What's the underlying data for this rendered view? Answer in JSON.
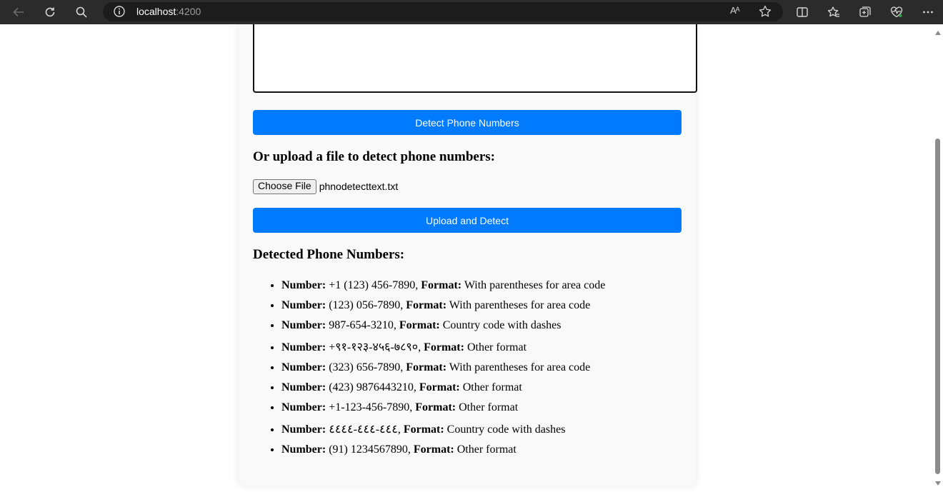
{
  "browser": {
    "url_host": "localhost",
    "url_port": ":4200",
    "read_aloud_glyph": "Aᴬ",
    "icons": [
      "back-icon",
      "refresh-icon",
      "search-icon",
      "site-info-icon",
      "read-aloud-icon",
      "favorite-star-icon",
      "split-screen-icon",
      "favorites-icon",
      "collections-icon",
      "browser-essentials-icon",
      "more-menu-icon"
    ]
  },
  "form": {
    "textarea_value": "",
    "detect_button": "Detect Phone Numbers",
    "upload_heading": "Or upload a file to detect phone numbers:",
    "choose_file_label": "Choose File",
    "file_name": "phnodetecttext.txt",
    "upload_button": "Upload and Detect"
  },
  "results": {
    "heading": "Detected Phone Numbers:",
    "number_label": "Number:",
    "format_label": "Format:",
    "items": [
      {
        "number": "+1 (123) 456-7890",
        "format": "With parentheses for area code"
      },
      {
        "number": "(123) 056-7890",
        "format": "With parentheses for area code"
      },
      {
        "number": "987-654-3210",
        "format": "Country code with dashes"
      },
      {
        "number": "+९१-१२३-४५६-७८९०",
        "format": "Other format"
      },
      {
        "number": "(323) 656-7890",
        "format": "With parentheses for area code"
      },
      {
        "number": "(423) 9876443210",
        "format": "Other format"
      },
      {
        "number": "+1-123-456-7890",
        "format": "Other format"
      },
      {
        "number": "٤٤٤-٤٤٤-٤٤٤٤",
        "format": "Country code with dashes"
      },
      {
        "number": "(91) 1234567890",
        "format": "Other format"
      }
    ]
  },
  "colors": {
    "accent": "#007bff",
    "chrome_bg": "#2b2b2b",
    "card_bg": "#f9f9f9"
  }
}
